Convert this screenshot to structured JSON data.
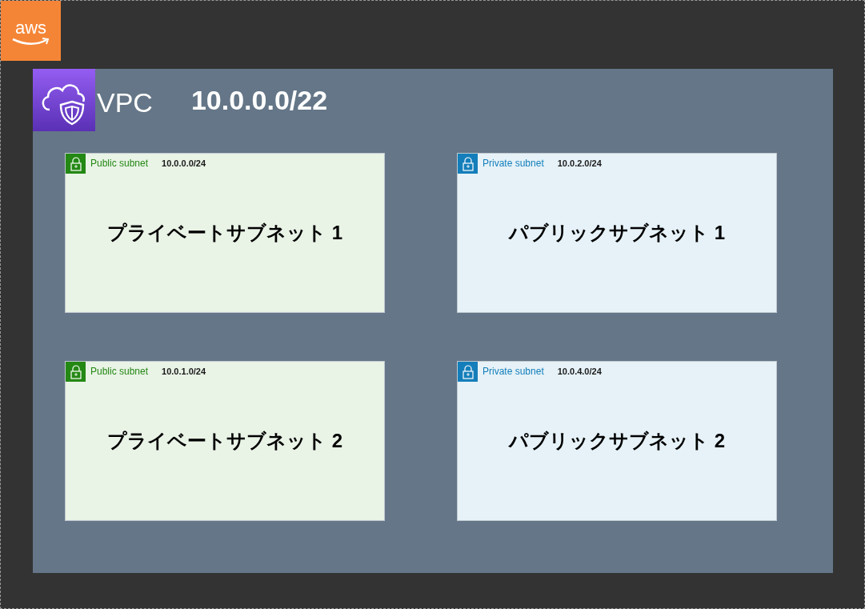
{
  "logo": {
    "text": "aws"
  },
  "vpc": {
    "label": "VPC",
    "cidr": "10.0.0.0/22"
  },
  "subnets": [
    {
      "kind": "public",
      "type_label": "Public subnet",
      "cidr": "10.0.0.0/24",
      "name": "プライベートサブネット 1"
    },
    {
      "kind": "private",
      "type_label": "Private subnet",
      "cidr": "10.0.2.0/24",
      "name": "パブリックサブネット 1"
    },
    {
      "kind": "public",
      "type_label": "Public subnet",
      "cidr": "10.0.1.0/24",
      "name": "プライベートサブネット 2"
    },
    {
      "kind": "private",
      "type_label": "Private subnet",
      "cidr": "10.0.4.0/24",
      "name": "パブリックサブネット 2"
    }
  ]
}
